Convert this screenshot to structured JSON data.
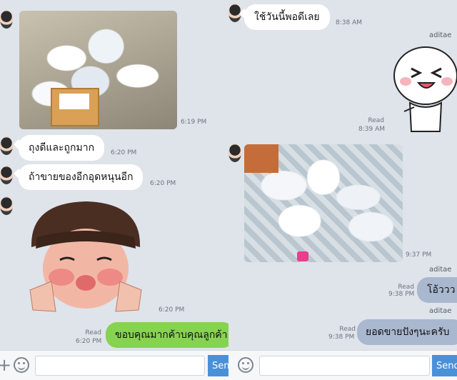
{
  "left": {
    "messages": {
      "m1_time": "6:19 PM",
      "m2_text": "ถุงดีและถูกมาก",
      "m2_time": "6:20 PM",
      "m3_text": "ถ้าขายของอีกอุดหนุนอีก",
      "m3_time": "6:20 PM",
      "m4_time": "6:20 PM",
      "m5_read": "Read",
      "m5_time": "6:20 PM",
      "m5_text": "ขอบคุณมากค้าบคุณลูกค้า"
    },
    "input": {
      "send_label": "Send"
    }
  },
  "right": {
    "messages": {
      "r1_text": "ใช้วันนี้พอดีเลย",
      "r1_time": "8:38 AM",
      "r2_name": "aditae",
      "r2_read": "Read",
      "r2_time": "8:39 AM",
      "r3_time": "9:37 PM",
      "r4_name": "aditae",
      "r4_read": "Read",
      "r4_time": "9:38 PM",
      "r4_text": "โอ้ววว",
      "r5_name": "aditae",
      "r5_read": "Read",
      "r5_time": "9:38 PM",
      "r5_text": "ยอดขายปังๆนะครับ"
    },
    "input": {
      "send_label": "Send"
    }
  },
  "colors": {
    "chat_bg": "#dfe3ea",
    "outgoing_green": "#86d34f",
    "outgoing_blue": "#a9b7cf",
    "send_button": "#4a90d9"
  }
}
